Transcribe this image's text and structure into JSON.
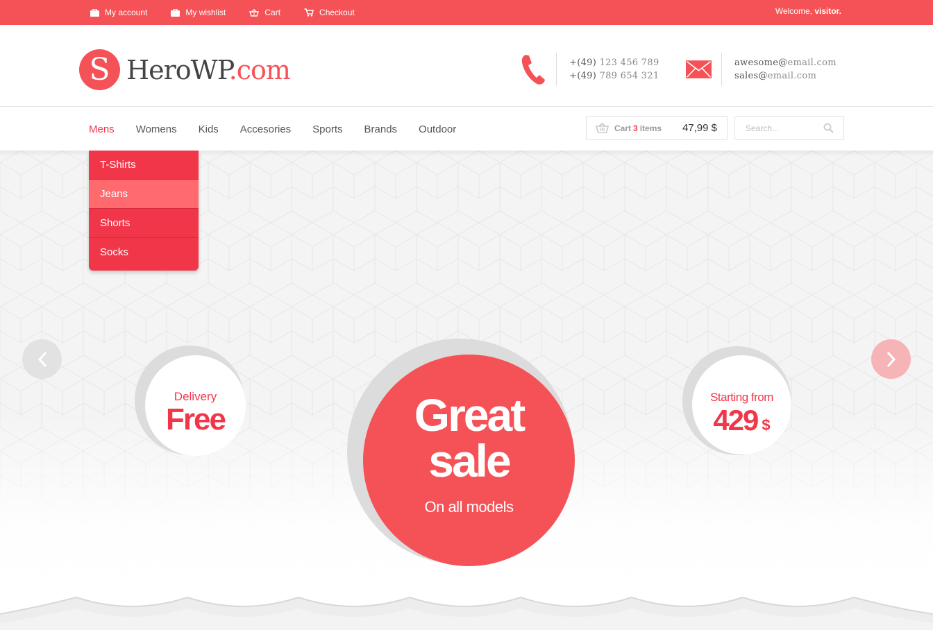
{
  "topbar": {
    "links": [
      {
        "label": "My account",
        "icon": "briefcase-icon"
      },
      {
        "label": "My wishlist",
        "icon": "briefcase-icon"
      },
      {
        "label": "Cart",
        "icon": "basket-icon"
      },
      {
        "label": "Checkout",
        "icon": "cart-icon"
      }
    ],
    "welcome_prefix": "Welcome,",
    "welcome_user": "visitor."
  },
  "brand": {
    "logo_letter": "S",
    "name": "HeroWP",
    "tld": ".com"
  },
  "contact": {
    "phones": [
      {
        "prefix": "+(49)",
        "number": "123 456 789"
      },
      {
        "prefix": "+(49)",
        "number": "789 654 321"
      }
    ],
    "emails": [
      {
        "user": "awesome@",
        "domain": "email.com"
      },
      {
        "user": "sales@",
        "domain": "email.com"
      }
    ]
  },
  "nav": {
    "items": [
      "Mens",
      "Womens",
      "Kids",
      "Accesories",
      "Sports",
      "Brands",
      "Outdoor"
    ],
    "active": "Mens"
  },
  "cart": {
    "label": "Cart",
    "count": "3",
    "items_word": "items",
    "total": "47,99 $"
  },
  "search": {
    "placeholder": "Search..."
  },
  "dropdown": {
    "items": [
      "T-Shirts",
      "Jeans",
      "Shorts",
      "Socks"
    ],
    "highlighted": "Jeans"
  },
  "hero": {
    "delivery_label": "Delivery",
    "delivery_value": "Free",
    "sale_line1": "Great",
    "sale_line2": "sale",
    "sale_sub": "On all models",
    "price_label": "Starting from",
    "price_value": "429",
    "price_currency": "$"
  },
  "colors": {
    "accent": "#f55257",
    "accent_dark": "#f2364a",
    "dropdown_hover": "#ff6a6f"
  }
}
